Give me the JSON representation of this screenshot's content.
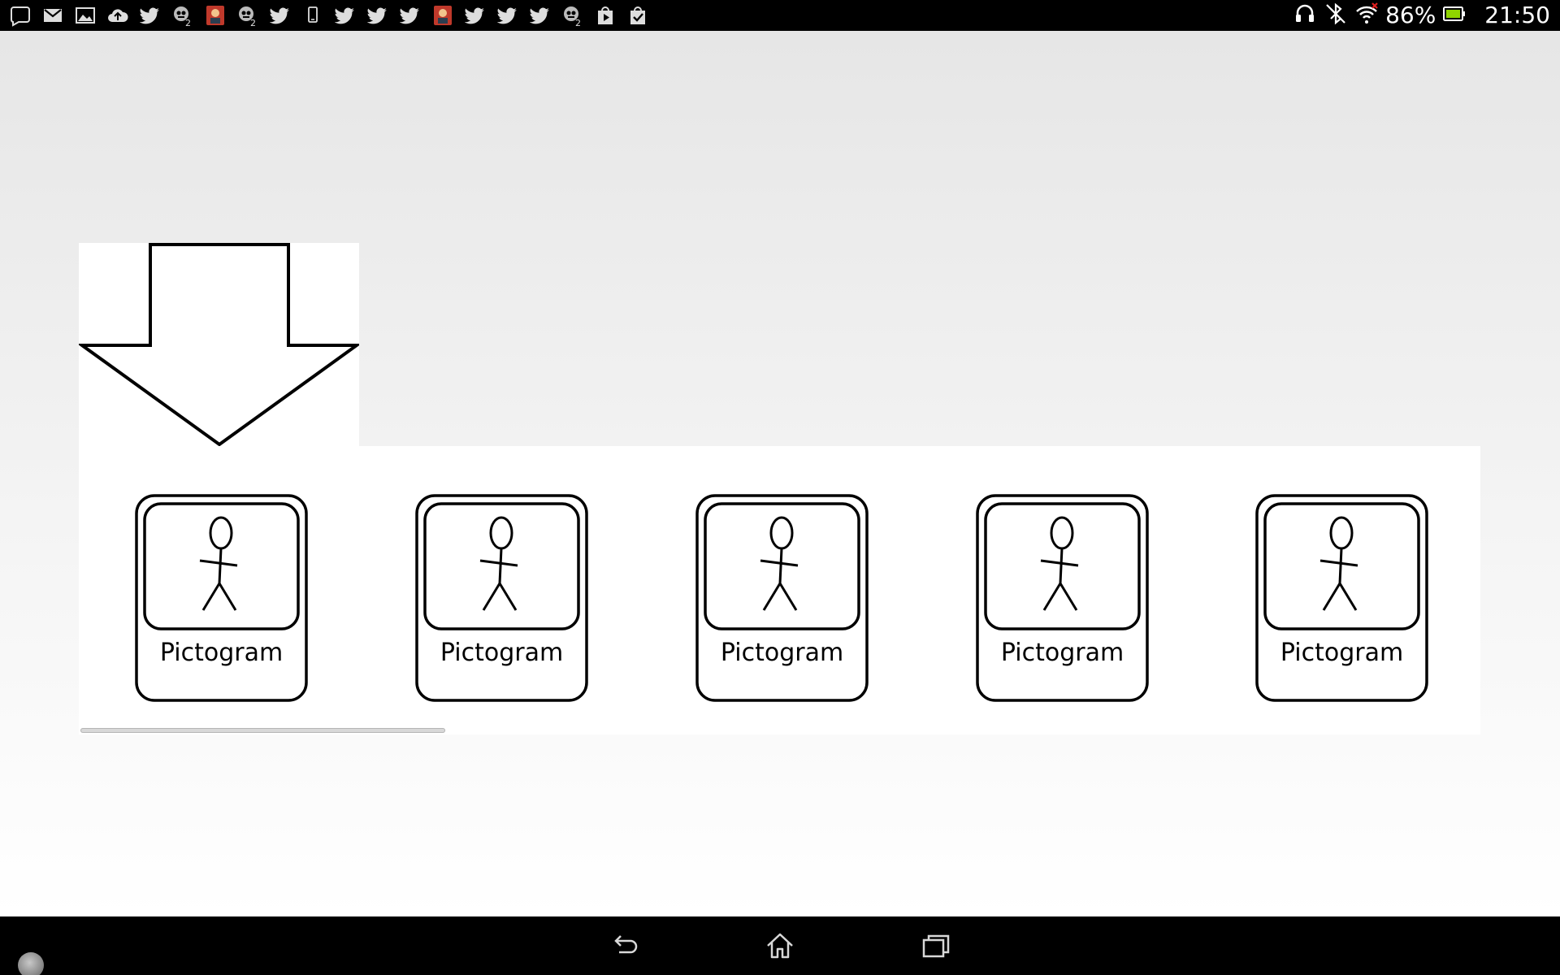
{
  "status_bar": {
    "notification_icons": [
      "chat-bubble-icon",
      "gmail-icon",
      "gallery-icon",
      "cloud-upload-icon",
      "twitter-icon",
      "game-badge-icon",
      "app-photo-icon",
      "game-badge-icon",
      "twitter-icon",
      "phone-device-icon",
      "twitter-icon",
      "twitter-icon",
      "twitter-icon",
      "app-photo-icon",
      "twitter-icon",
      "twitter-icon",
      "twitter-icon",
      "game-badge-icon",
      "play-store-icon",
      "shopping-bag-icon"
    ],
    "battery_percent": "86%",
    "time": "21:50"
  },
  "pictogram_strip": {
    "cards": [
      {
        "label": "Pictogram"
      },
      {
        "label": "Pictogram"
      },
      {
        "label": "Pictogram"
      },
      {
        "label": "Pictogram"
      },
      {
        "label": "Pictogram"
      }
    ],
    "scroll_fraction_visible": 0.26
  },
  "navigation": {
    "icons": [
      "back-icon",
      "home-icon",
      "recent-apps-icon"
    ]
  }
}
